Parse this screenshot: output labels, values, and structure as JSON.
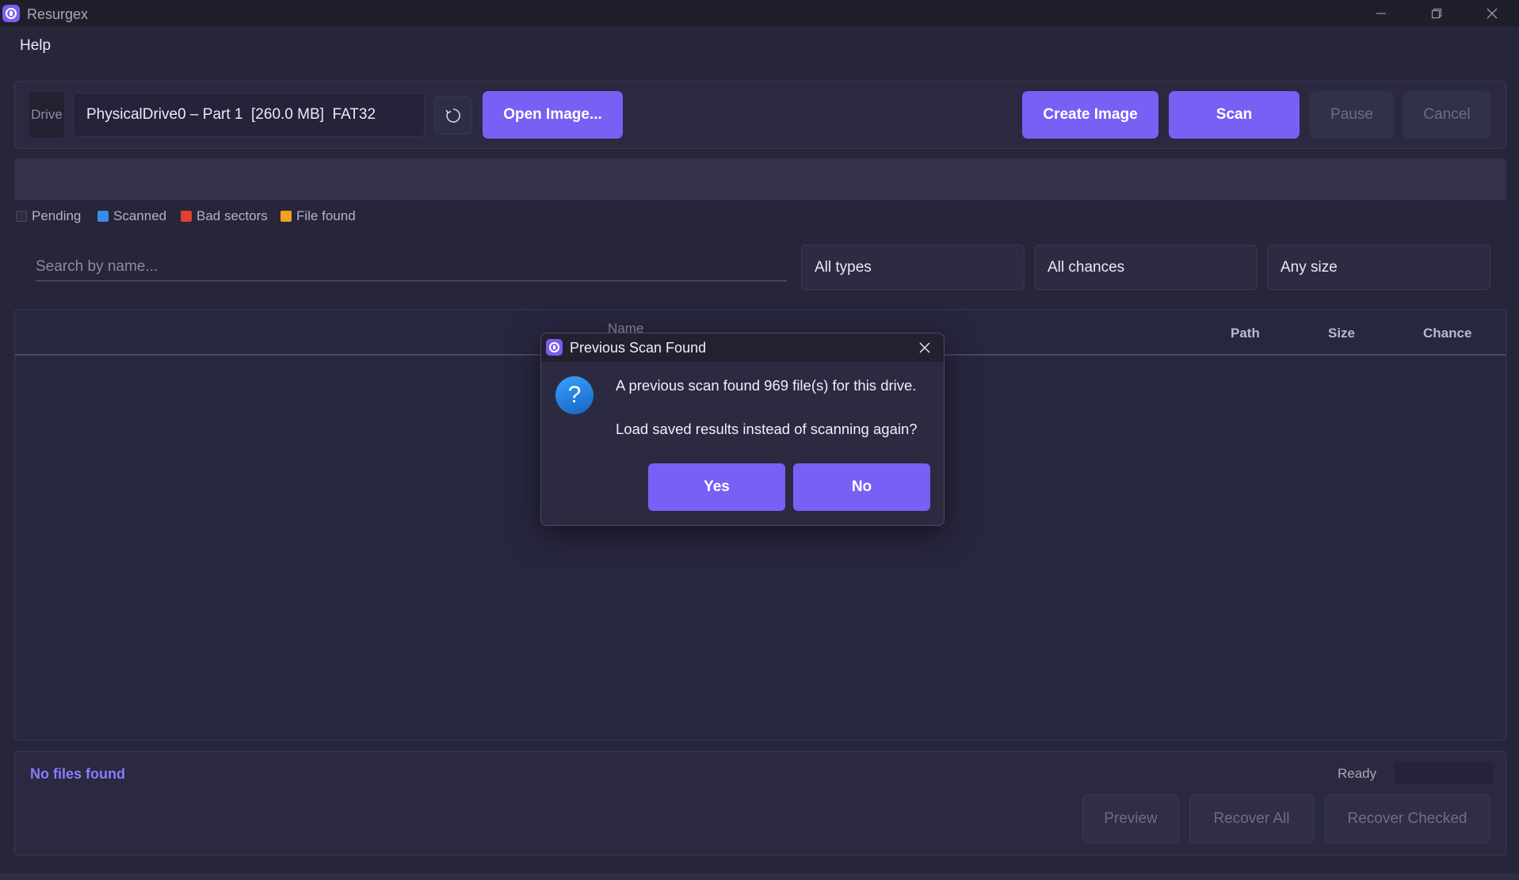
{
  "window": {
    "title": "Resurgex"
  },
  "menu": {
    "help": "Help"
  },
  "toolbar": {
    "drive_label": "Drive",
    "drive_value": "PhysicalDrive0 – Part 1  [260.0 MB]  FAT32",
    "open_image": "Open Image...",
    "create_image": "Create Image",
    "scan": "Scan",
    "pause": "Pause",
    "cancel": "Cancel"
  },
  "legend": [
    {
      "label": "Pending",
      "color": "#3a3950"
    },
    {
      "label": "Scanned",
      "color": "#3b8beb"
    },
    {
      "label": "Bad sectors",
      "color": "#e0402f"
    },
    {
      "label": "File found",
      "color": "#f2a020"
    }
  ],
  "filters": {
    "search_placeholder": "Search by name...",
    "types": "All types",
    "chances": "All chances",
    "size": "Any size"
  },
  "table": {
    "columns": {
      "name": "Name",
      "path": "Path",
      "size": "Size",
      "chance": "Chance"
    }
  },
  "footer": {
    "summary": "No files found",
    "status": "Ready",
    "preview": "Preview",
    "recover_all": "Recover All",
    "recover_checked": "Recover Checked"
  },
  "dialog": {
    "title": "Previous Scan Found",
    "message_line1": "A previous scan found 969 file(s) for this drive.",
    "message_line2": "Load saved results instead of scanning again?",
    "yes": "Yes",
    "no": "No"
  },
  "colors": {
    "accent": "#7a5ff5",
    "background": "#26253a",
    "summary_text": "#8b7bff"
  }
}
